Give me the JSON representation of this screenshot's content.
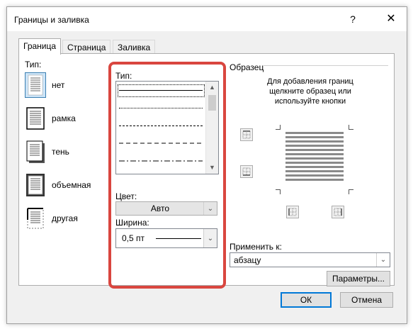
{
  "dialog": {
    "title": "Границы и заливка",
    "help_icon": "?",
    "close_icon": "✕"
  },
  "tabs": [
    {
      "label": "Граница",
      "active": true
    },
    {
      "label": "Страница",
      "active": false
    },
    {
      "label": "Заливка",
      "active": false
    }
  ],
  "setting": {
    "label": "Тип:",
    "items": [
      {
        "label": "нет",
        "icon": "border-none-icon",
        "selected": true
      },
      {
        "label": "рамка",
        "icon": "border-box-icon",
        "selected": false
      },
      {
        "label": "тень",
        "icon": "border-shadow-icon",
        "selected": false
      },
      {
        "label": "объемная",
        "icon": "border-3d-icon",
        "selected": false
      },
      {
        "label": "другая",
        "icon": "border-custom-icon",
        "selected": false
      }
    ]
  },
  "style": {
    "label": "Тип:",
    "line_styles": [
      "solid",
      "dotted",
      "dashed-fine",
      "dashed",
      "dash-dot"
    ],
    "selected_index": 0
  },
  "color": {
    "label": "Цвет:",
    "value": "Авто"
  },
  "width": {
    "label": "Ширина:",
    "value": "0,5 пт"
  },
  "preview": {
    "label": "Образец",
    "instruction_line1": "Для добавления границ",
    "instruction_line2": "щелкните образец или",
    "instruction_line3": "используйте кнопки"
  },
  "apply_to": {
    "label": "Применить к:",
    "value": "абзацу"
  },
  "buttons": {
    "options": "Параметры...",
    "ok": "ОК",
    "cancel": "Отмена"
  },
  "colors": {
    "highlight": "#d9463f",
    "accent": "#0078d7"
  }
}
